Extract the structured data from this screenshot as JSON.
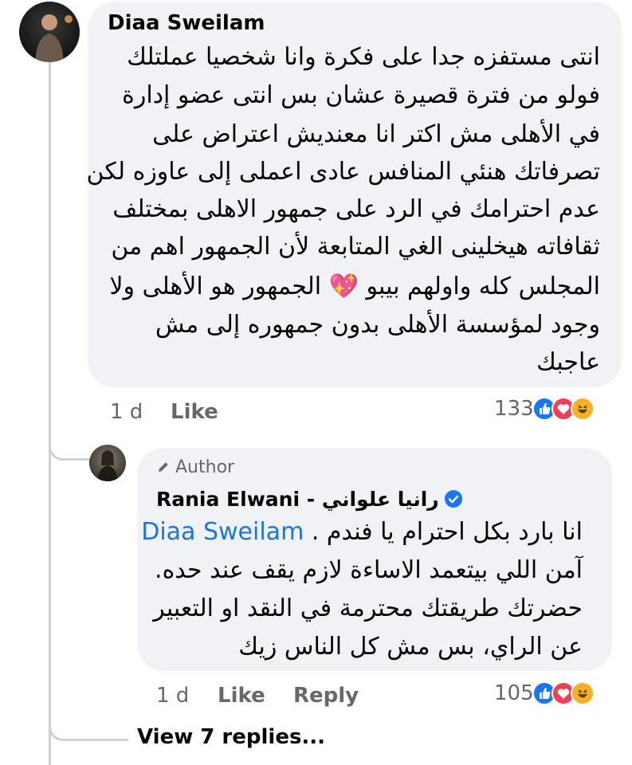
{
  "comment": {
    "author": "Diaa Sweilam",
    "lines": [
      "انتى مستفزه جدا على فكرة وانا شخصيا عملتلك",
      "فولو من فترة قصيرة عشان بس انتى عضو إدارة",
      "في الأهلى مش اكتر انا معنديش اعتراض على",
      "تصرفاتك هنئي المنافس عادى اعملى إلى عاوزه لكن",
      "عدم احترامك في الرد على جمهور الاهلى بمختلف",
      "ثقافاته هيخلينى الغي المتابعة لأن الجمهور اهم من",
      "المجلس كله واولهم بيبو 💖 الجمهور هو الأهلى ولا",
      "وجود لمؤسسة الأهلى بدون جمهوره إلى مش",
      "عاجبك"
    ],
    "time": "1 d",
    "like_label": "Like",
    "reaction_count": "133"
  },
  "reply": {
    "author_tag": "Author",
    "author": "Rania Elwani - رانيا علواني",
    "mention": "Diaa Sweilam",
    "first_line_text": "انا بارد بكل احترام يا فندم .",
    "lines": [
      "آمن اللي بيتعمد الاساءة لازم يقف عند حده.",
      "حضرتك طريقتك محترمة في النقد او التعبير",
      "عن الراي، بس مش كل الناس زيك"
    ],
    "time": "1 d",
    "like_label": "Like",
    "reply_label": "Reply",
    "reaction_count": "105"
  },
  "view_replies_label": "View 7 replies...",
  "colors": {
    "bubble": "#f0f2f5",
    "meta_text": "#65676b",
    "link": "#1b74e4",
    "like_blue": "#1877f2",
    "love_red": "#f33e58",
    "haha_yellow": "#f7b125"
  },
  "icons": [
    "pencil-icon",
    "verified-icon",
    "like-reaction-icon",
    "love-reaction-icon",
    "haha-reaction-icon"
  ]
}
